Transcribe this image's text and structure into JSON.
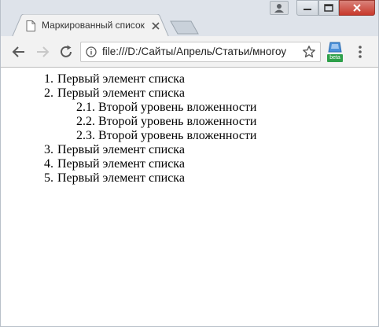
{
  "tab": {
    "title": "Маркированный список",
    "icon": "page-icon"
  },
  "toolbar": {
    "url": "file:///D:/Сайты/Апрель/Статьи/многоу",
    "extension_badge": "beta"
  },
  "list": [
    {
      "num": "1.",
      "text": "Первый элемент списка",
      "level": 1
    },
    {
      "num": "2.",
      "text": "Первый элемент списка",
      "level": 1
    },
    {
      "num": "2.1.",
      "text": "Второй уровень вложенности",
      "level": 2
    },
    {
      "num": "2.2.",
      "text": "Второй уровень вложенности",
      "level": 2
    },
    {
      "num": "2.3.",
      "text": "Второй уровень вложенности",
      "level": 2
    },
    {
      "num": "3.",
      "text": "Первый элемент списка",
      "level": 1
    },
    {
      "num": "4.",
      "text": "Первый элемент списка",
      "level": 1
    },
    {
      "num": "5.",
      "text": "Первый элемент списка",
      "level": 1
    }
  ]
}
